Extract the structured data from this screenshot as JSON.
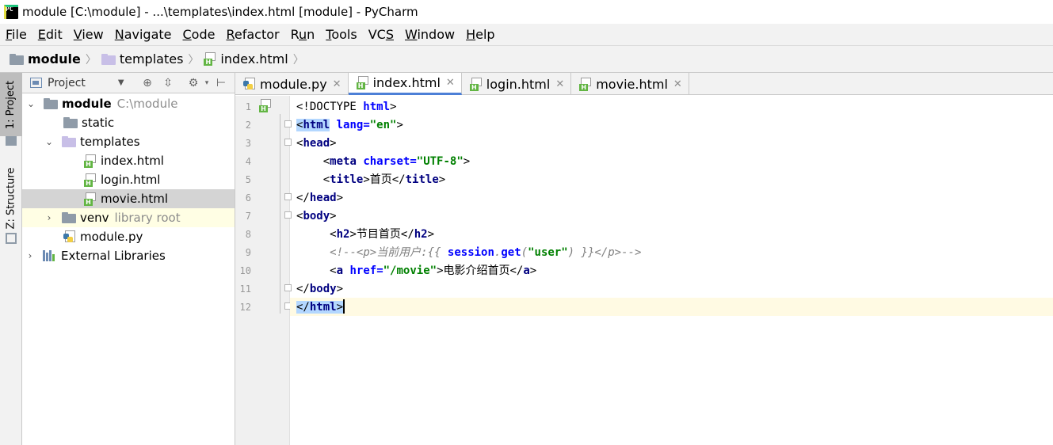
{
  "window": {
    "title": "module [C:\\module] - ...\\templates\\index.html [module] - PyCharm",
    "app_icon": "PC"
  },
  "menu": [
    {
      "label": "File",
      "u": "F",
      "rest": "ile"
    },
    {
      "label": "Edit",
      "u": "E",
      "rest": "dit"
    },
    {
      "label": "View",
      "u": "V",
      "rest": "iew"
    },
    {
      "label": "Navigate",
      "u": "N",
      "rest": "avigate"
    },
    {
      "label": "Code",
      "u": "C",
      "rest": "ode"
    },
    {
      "label": "Refactor",
      "u": "R",
      "rest": "efactor"
    },
    {
      "label": "Run",
      "pre": "R",
      "u": "u",
      "rest": "n"
    },
    {
      "label": "Tools",
      "u": "T",
      "rest": "ools"
    },
    {
      "label": "VCS",
      "pre": "VC",
      "u": "S",
      "rest": ""
    },
    {
      "label": "Window",
      "u": "W",
      "rest": "indow"
    },
    {
      "label": "Help",
      "u": "H",
      "rest": "elp"
    }
  ],
  "breadcrumb": {
    "root": "module",
    "folder": "templates",
    "file": "index.html"
  },
  "tool_strip": {
    "project": "1: Project",
    "structure": "Z: Structure"
  },
  "project_panel": {
    "title": "Project",
    "tree": {
      "root": {
        "name": "module",
        "path": "C:\\module"
      },
      "static": "static",
      "templates": "templates",
      "files": [
        "index.html",
        "login.html",
        "movie.html"
      ],
      "venv": {
        "name": "venv",
        "hint": "library root"
      },
      "module_py": "module.py",
      "external": "External Libraries"
    }
  },
  "tabs": [
    "module.py",
    "index.html",
    "login.html",
    "movie.html"
  ],
  "active_tab": "index.html",
  "editor": {
    "line_numbers": [
      "1",
      "2",
      "3",
      "4",
      "5",
      "6",
      "7",
      "8",
      "9",
      "10",
      "11",
      "12"
    ],
    "lines": {
      "l1_doctype": "<!DOCTYPE ",
      "l1_html": "html",
      "l2_html": "html",
      "l2_attr": "lang",
      "l2_val": "\"en\"",
      "l3_head": "head",
      "l4_meta": "meta",
      "l4_attr": "charset",
      "l4_val": "\"UTF-8\"",
      "l5_title": "title",
      "l5_text": "首页",
      "l6_head": "head",
      "l7_body": "body",
      "l8_h2": "h2",
      "l8_text": "节目首页",
      "l9_open": "<!--",
      "l9_p": "p",
      "l9_text": "当前用户:{{ ",
      "l9_session": "session",
      "l9_dot": ".",
      "l9_get": "get",
      "l9_arg": "\"user\"",
      "l9_end": ") }}",
      "l9_close": "-->",
      "l10_a": "a",
      "l10_attr": "href",
      "l10_val": "\"/movie\"",
      "l10_text": "电影介绍首页",
      "l11_body": "body",
      "l12_html": "html"
    }
  },
  "colors": {
    "accent": "#4d80d7",
    "tag": "#000080",
    "attr": "#0000ff",
    "string": "#008000",
    "caret_line": "#fffae3"
  }
}
